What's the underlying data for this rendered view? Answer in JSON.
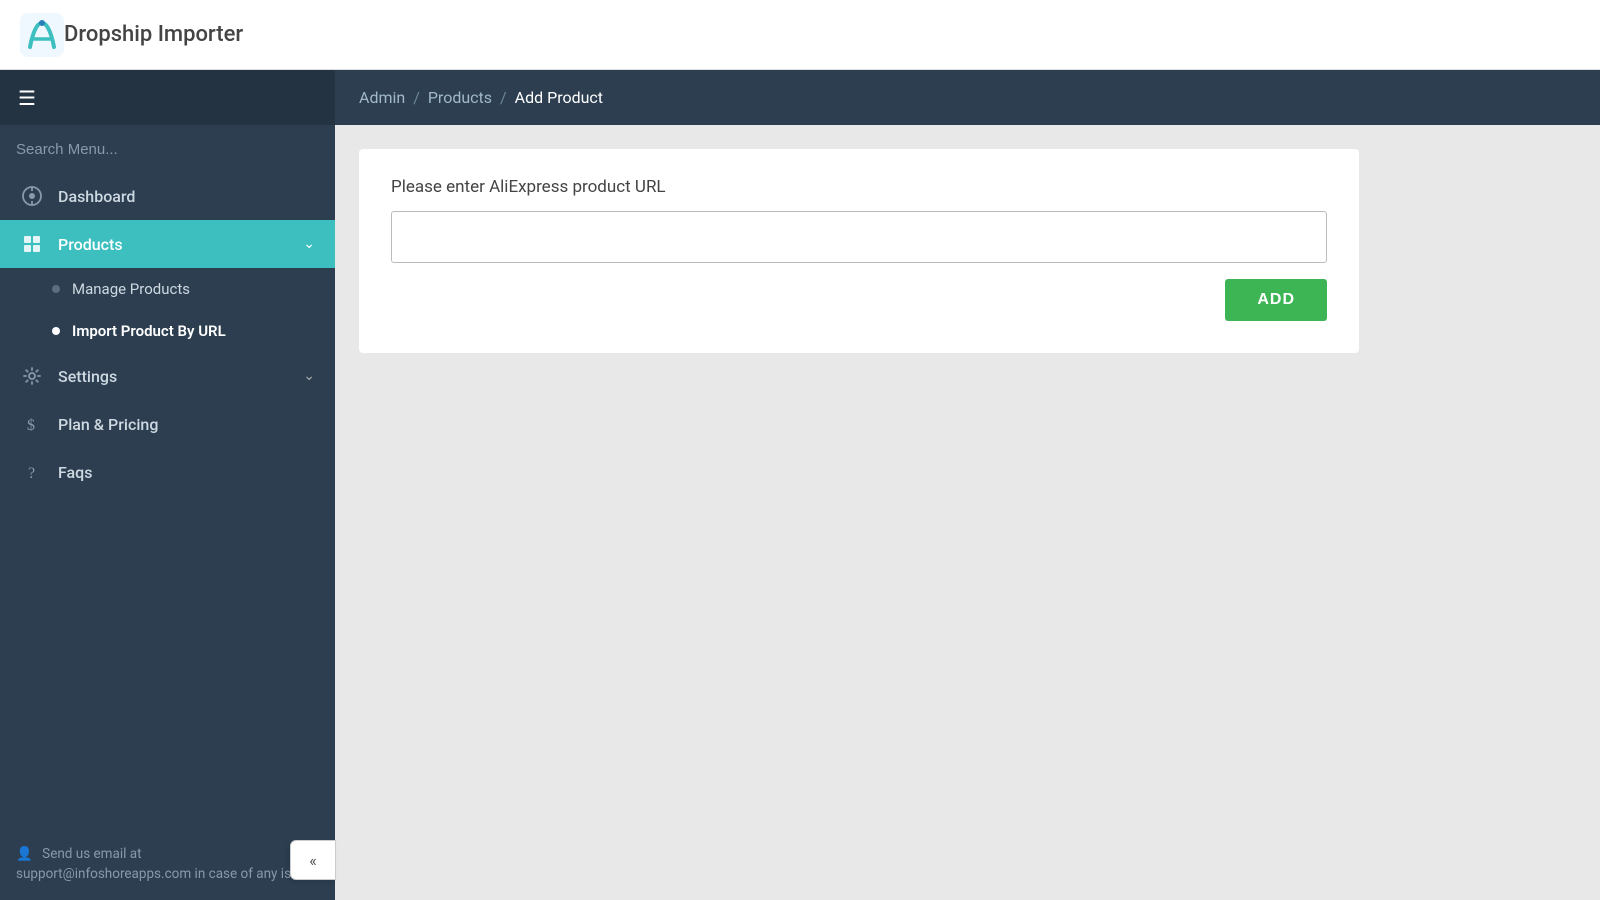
{
  "app": {
    "title": "Dropship Importer"
  },
  "header": {
    "logo_alt": "Dropship Importer logo"
  },
  "breadcrumb": {
    "items": [
      {
        "label": "Admin",
        "active": false
      },
      {
        "label": "Products",
        "active": false
      },
      {
        "label": "Add Product",
        "active": true
      }
    ]
  },
  "sidebar": {
    "search_placeholder": "Search Menu...",
    "items": [
      {
        "id": "dashboard",
        "label": "Dashboard",
        "icon": "dashboard-icon",
        "has_chevron": false,
        "active": false
      },
      {
        "id": "products",
        "label": "Products",
        "icon": "products-icon",
        "has_chevron": true,
        "active": true,
        "subitems": [
          {
            "id": "manage-products",
            "label": "Manage Products",
            "active": false
          },
          {
            "id": "import-product-by-url",
            "label": "Import Product By URL",
            "active": true
          }
        ]
      },
      {
        "id": "settings",
        "label": "Settings",
        "icon": "settings-icon",
        "has_chevron": true,
        "active": false
      },
      {
        "id": "plan-pricing",
        "label": "Plan & Pricing",
        "icon": "dollar-icon",
        "has_chevron": false,
        "active": false
      },
      {
        "id": "faqs",
        "label": "Faqs",
        "icon": "help-icon",
        "has_chevron": false,
        "active": false
      }
    ],
    "footer_text": "Send us email at support@infoshoreapps.com in case of any issue.",
    "footer_icon": "user-icon",
    "collapse_icon": "«"
  },
  "main": {
    "card": {
      "title": "Please enter AliExpress product URL",
      "input_placeholder": "",
      "add_button_label": "ADD"
    }
  },
  "colors": {
    "sidebar_bg": "#2c3e50",
    "active_nav": "#3dbfbf",
    "add_btn": "#3db554",
    "breadcrumb_bg": "#2c3e50"
  }
}
